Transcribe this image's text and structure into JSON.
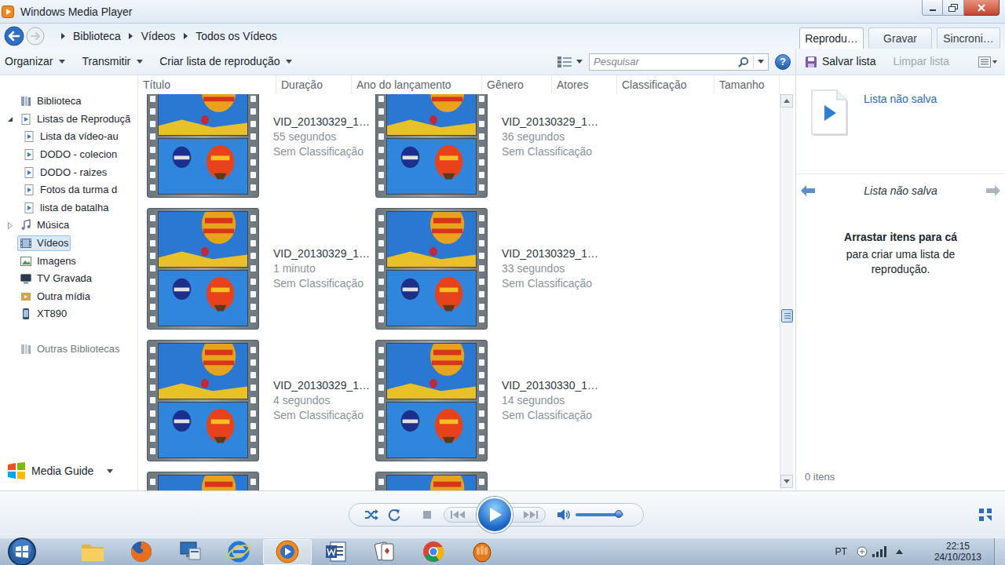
{
  "window": {
    "title": "Windows Media Player"
  },
  "breadcrumb": [
    "Biblioteca",
    "Vídeos",
    "Todos os Vídeos"
  ],
  "tabs": [
    {
      "label": "Reprodu…",
      "selected": true
    },
    {
      "label": "Gravar",
      "selected": false
    },
    {
      "label": "Sincroni…",
      "selected": false
    }
  ],
  "toolbar": {
    "menus": [
      "Organizar",
      "Transmitir",
      "Criar lista de reprodução"
    ],
    "help": "?"
  },
  "search": {
    "placeholder": "Pesquisar"
  },
  "columns": [
    "Título",
    "Duração",
    "Ano do lançamento",
    "Gênero",
    "Atores",
    "Classificação",
    "Tamanho"
  ],
  "sidebar": {
    "items": [
      {
        "label": "Biblioteca",
        "kind": "root",
        "selected": false
      },
      {
        "label": "Listas de Reproduçã",
        "kind": "group",
        "expanded": true,
        "selected": false
      },
      {
        "label": "Lista da vídeo-au",
        "kind": "child",
        "selected": false
      },
      {
        "label": "DODO - colecion",
        "kind": "child",
        "selected": false
      },
      {
        "label": "DODO - raizes",
        "kind": "child",
        "selected": false
      },
      {
        "label": "Fotos da turma d",
        "kind": "child",
        "selected": false
      },
      {
        "label": "lista de batalha",
        "kind": "child",
        "selected": false
      },
      {
        "label": "Música",
        "kind": "group",
        "expanded": false,
        "selected": false
      },
      {
        "label": "Vídeos",
        "kind": "root",
        "selected": true
      },
      {
        "label": "Imagens",
        "kind": "root",
        "selected": false
      },
      {
        "label": "TV Gravada",
        "kind": "root",
        "selected": false
      },
      {
        "label": "Outra mídia",
        "kind": "root",
        "selected": false
      },
      {
        "label": "XT890",
        "kind": "root",
        "selected": false
      },
      {
        "label": "Outras Bibliotecas",
        "kind": "section",
        "selected": false
      }
    ],
    "footer": "Media Guide"
  },
  "videos": [
    {
      "title": "VID_20130329_1…",
      "duration": "55 segundos",
      "rating": "Sem Classificação"
    },
    {
      "title": "VID_20130329_1…",
      "duration": "36 segundos",
      "rating": "Sem Classificação"
    },
    {
      "title": "VID_20130329_1…",
      "duration": "1 minuto",
      "rating": "Sem Classificação"
    },
    {
      "title": "VID_20130329_1…",
      "duration": "33 segundos",
      "rating": "Sem Classificação"
    },
    {
      "title": "VID_20130329_1…",
      "duration": "4 segundos",
      "rating": "Sem Classificação"
    },
    {
      "title": "VID_20130330_1…",
      "duration": "14 segundos",
      "rating": "Sem Classificação"
    }
  ],
  "partial_tiles": 2,
  "scrollbar": {
    "level": 0.57
  },
  "playlist": {
    "save": "Salvar lista",
    "clear": {
      "label": "Limpar lista",
      "disabled": true
    },
    "title": "Lista não salva",
    "nav_title": "Lista não salva",
    "drop_heading": "Arrastar itens para cá",
    "drop_text": "para criar uma lista de reprodução.",
    "count": "0 itens"
  },
  "player": {
    "volume": {
      "level": 0.9
    }
  },
  "taskbar": {
    "apps": [
      {
        "selected": false
      },
      {
        "selected": false
      },
      {
        "selected": false
      },
      {
        "selected": false
      },
      {
        "selected": true
      },
      {
        "selected": false
      },
      {
        "selected": false
      },
      {
        "selected": false
      },
      {
        "selected": false
      }
    ],
    "language": "PT",
    "time": "22:15",
    "date": "24/10/2013"
  }
}
